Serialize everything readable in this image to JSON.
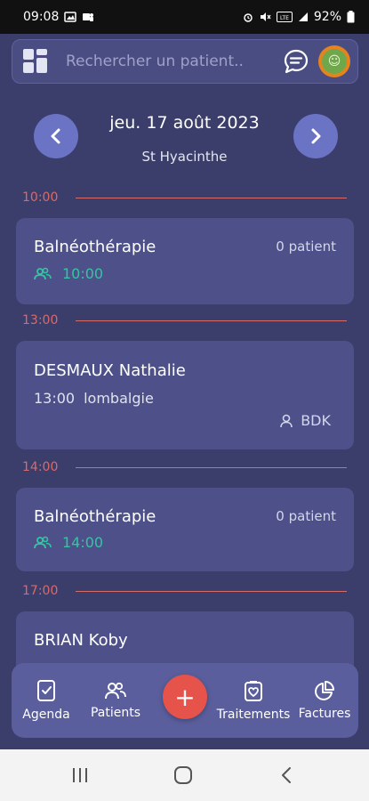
{
  "status_bar": {
    "time": "09:08",
    "battery": "92%"
  },
  "search": {
    "placeholder": "Rechercher un patient.."
  },
  "header": {
    "date": "jeu. 17 août 2023",
    "place": "St Hyacinthe"
  },
  "timeline": [
    {
      "time": "10:00"
    },
    {
      "time": "13:00"
    },
    {
      "time": "14:00"
    },
    {
      "time": "17:00"
    }
  ],
  "cards": [
    {
      "title": "Balnéothérapie",
      "count": "0 patient",
      "time": "10:00",
      "icon": "group-icon"
    },
    {
      "title": "DESMAUX Nathalie",
      "time": "13:00",
      "reason": "lombalgie",
      "practitioner": "BDK",
      "icon": "user-icon"
    },
    {
      "title": "Balnéothérapie",
      "count": "0 patient",
      "time": "14:00",
      "icon": "group-icon"
    },
    {
      "title": "BRIAN Koby"
    }
  ],
  "bottom_nav": {
    "items": [
      {
        "label": "Agenda",
        "icon": "calendar-check-icon"
      },
      {
        "label": "Patients",
        "icon": "users-icon"
      },
      {
        "label": "Traitements",
        "icon": "clipboard-heart-icon"
      },
      {
        "label": "Factures",
        "icon": "pie-chart-icon"
      }
    ],
    "fab": "+"
  },
  "colors": {
    "background": "#3b3d6b",
    "card": "#4e5189",
    "accent_teal": "#35c4a2",
    "timeline_red": "#d96a6a",
    "fab_red": "#e5534b",
    "nav_button": "#6b73c5"
  }
}
